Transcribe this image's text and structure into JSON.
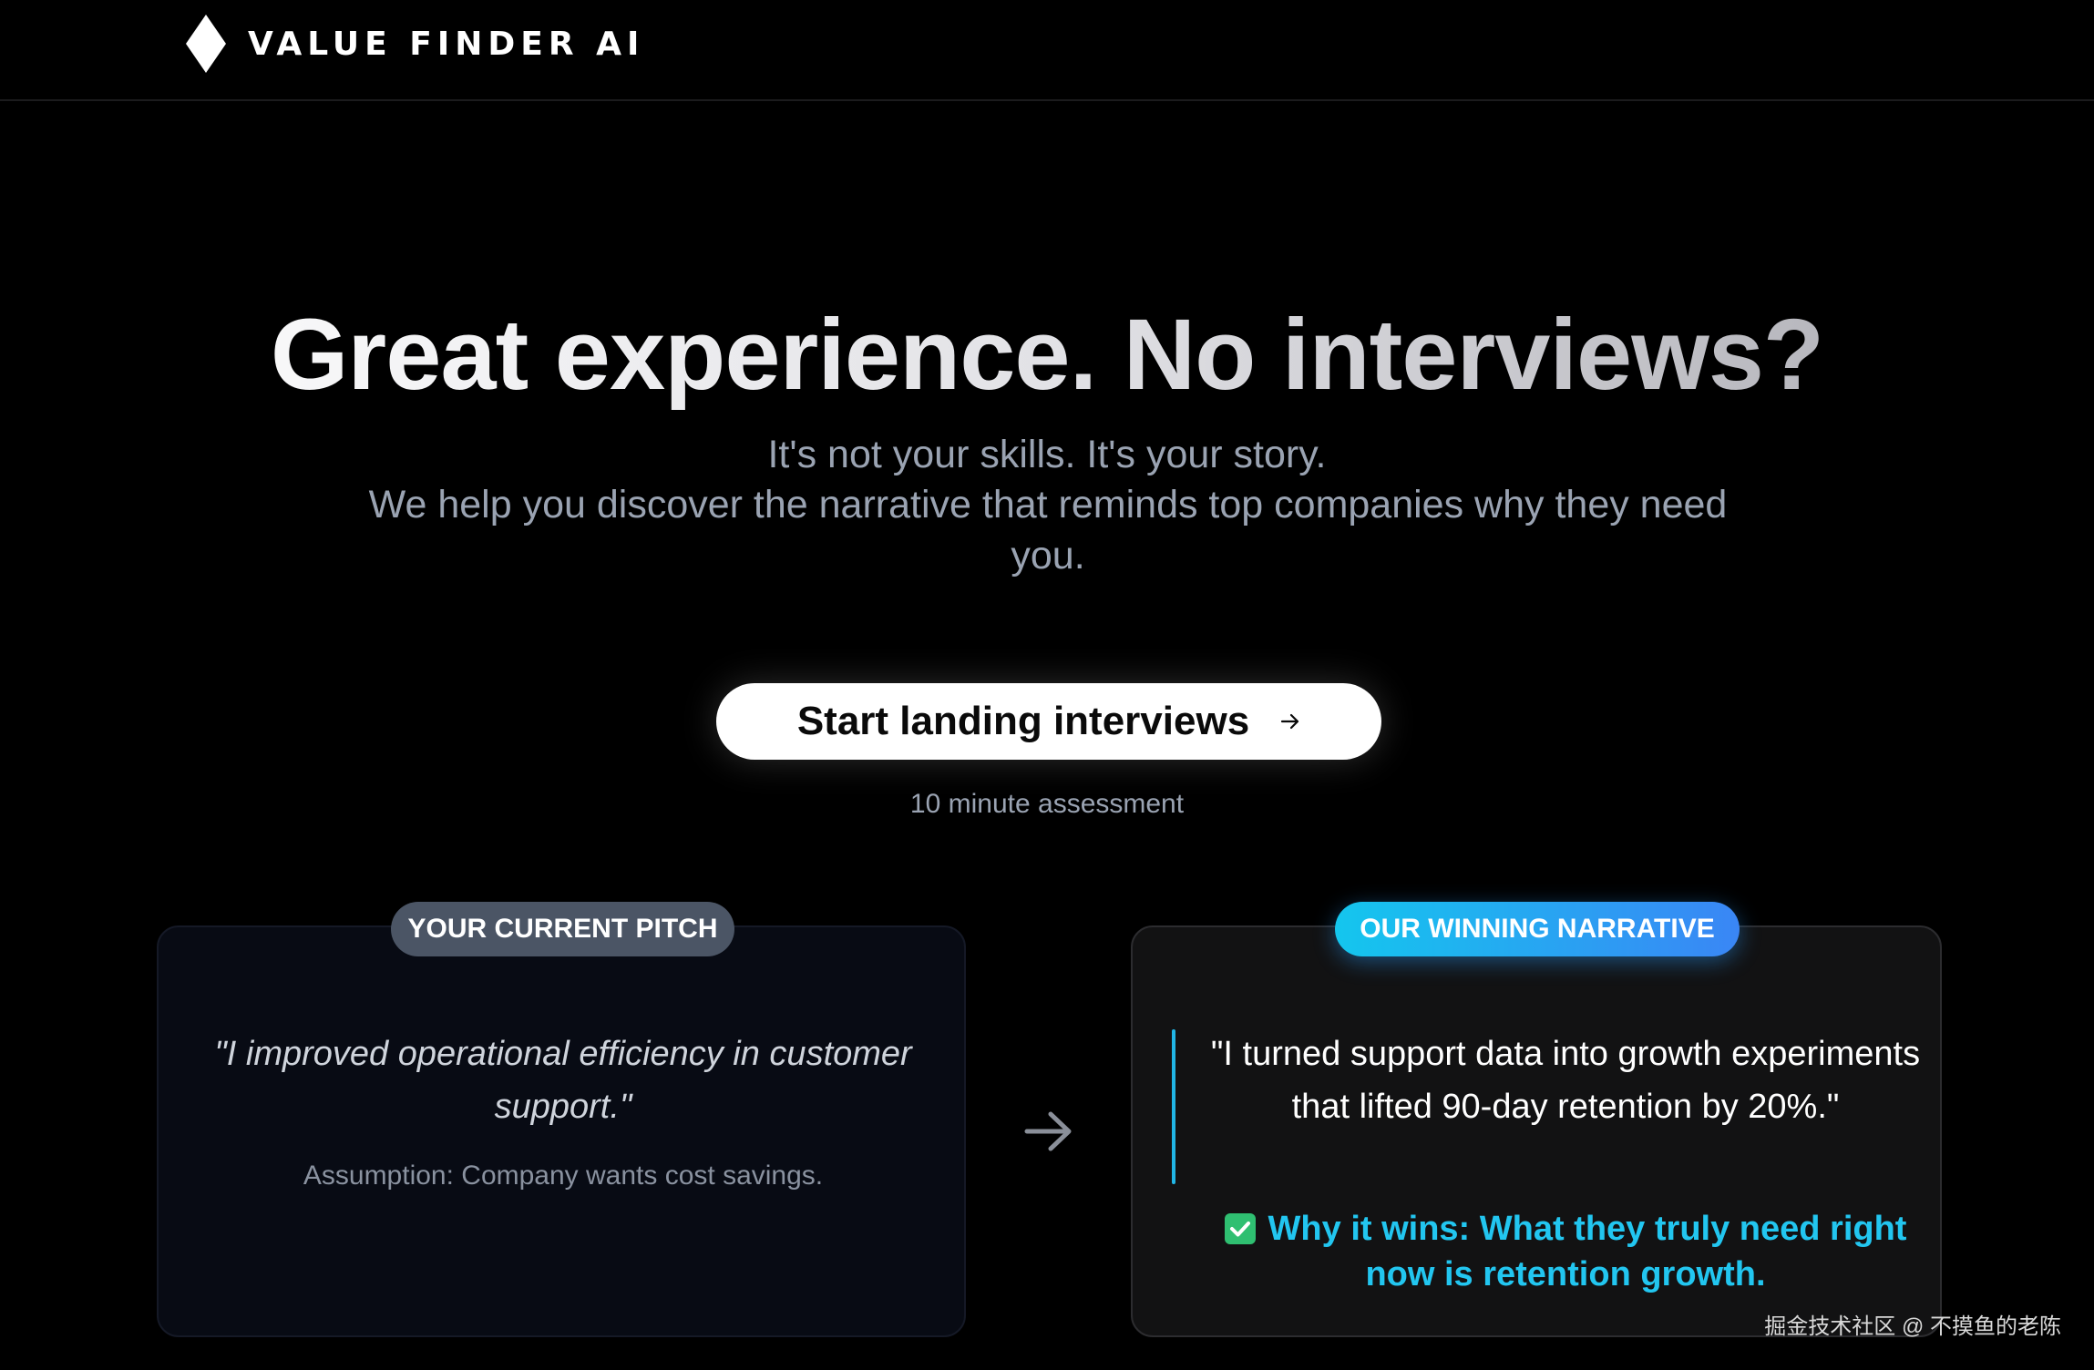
{
  "header": {
    "brand_name": "VALUE FINDER AI",
    "logo_icon": "diamond-icon"
  },
  "hero": {
    "title": "Great experience. No interviews?",
    "tagline": "It's not your skills. It's your story.",
    "subtitle": "We help you discover the narrative that reminds top companies why they need you."
  },
  "cta": {
    "label": "Start landing interviews",
    "icon": "arrow-right-icon",
    "note": "10 minute assessment"
  },
  "comparison": {
    "current": {
      "badge": "YOUR CURRENT PITCH",
      "quote": "\"I improved operational efficiency in customer support.\"",
      "assumption": "Assumption: Company wants cost savings."
    },
    "arrow_icon": "arrow-right-icon",
    "winning": {
      "badge": "OUR WINNING NARRATIVE",
      "quote": "\"I turned support data into growth experiments that lifted 90-day retention by 20%.\"",
      "why_icon": "check-icon",
      "why": "Why it wins: What they truly need right now is retention growth."
    }
  },
  "watermark": "掘金技术社区 @ 不摸鱼的老陈",
  "colors": {
    "background": "#000000",
    "accent_cyan": "#22c6f0",
    "badge_gray": "#4b5565",
    "badge_gradient_start": "#14c6ee",
    "badge_gradient_end": "#3a86f5",
    "check_green": "#2fbf71"
  }
}
